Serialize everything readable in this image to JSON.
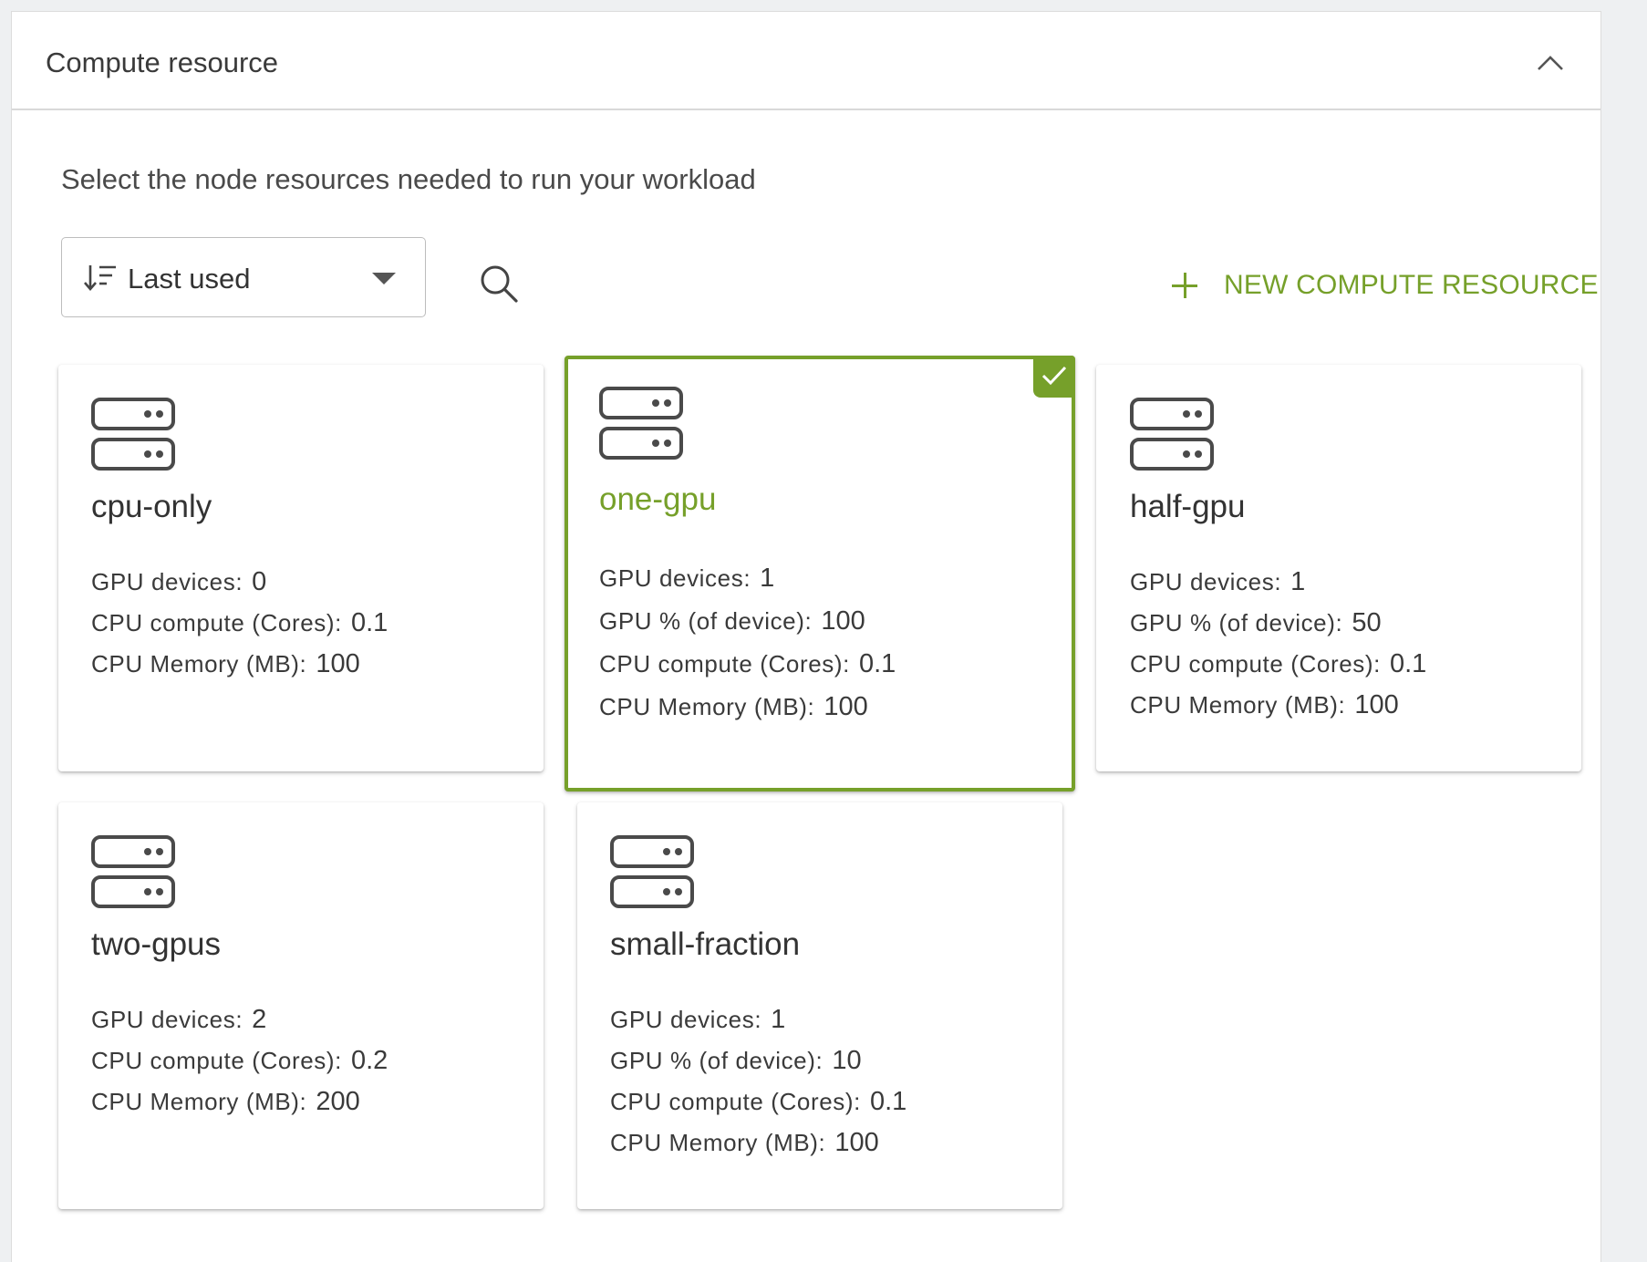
{
  "panel": {
    "title": "Compute resource",
    "collapse_icon": "chevron-up-icon"
  },
  "intro_text": "Select the node resources needed to run your workload",
  "toolbar": {
    "sort_label": "Last used",
    "sort_icon": "sort-descending-icon",
    "search_icon": "search-icon",
    "new_label": "NEW COMPUTE RESOURCE",
    "accent_color": "#76a02a"
  },
  "cards": [
    {
      "name": "cpu-only",
      "selected": false,
      "specs": [
        {
          "label": "GPU devices:",
          "value": "0"
        },
        {
          "label": "CPU compute (Cores):",
          "value": "0.1"
        },
        {
          "label": "CPU Memory (MB):",
          "value": "100"
        }
      ]
    },
    {
      "name": "one-gpu",
      "selected": true,
      "specs": [
        {
          "label": "GPU devices:",
          "value": "1"
        },
        {
          "label": "GPU % (of device):",
          "value": "100"
        },
        {
          "label": "CPU compute (Cores):",
          "value": "0.1"
        },
        {
          "label": "CPU Memory (MB):",
          "value": "100"
        }
      ]
    },
    {
      "name": "half-gpu",
      "selected": false,
      "specs": [
        {
          "label": "GPU devices:",
          "value": "1"
        },
        {
          "label": "GPU % (of device):",
          "value": "50"
        },
        {
          "label": "CPU compute (Cores):",
          "value": "0.1"
        },
        {
          "label": "CPU Memory (MB):",
          "value": "100"
        }
      ]
    },
    {
      "name": "two-gpus",
      "selected": false,
      "specs": [
        {
          "label": "GPU devices:",
          "value": "2"
        },
        {
          "label": "CPU compute (Cores):",
          "value": "0.2"
        },
        {
          "label": "CPU Memory (MB):",
          "value": "200"
        }
      ]
    },
    {
      "name": "small-fraction",
      "selected": false,
      "specs": [
        {
          "label": "GPU devices:",
          "value": "1"
        },
        {
          "label": "GPU % (of device):",
          "value": "10"
        },
        {
          "label": "CPU compute (Cores):",
          "value": "0.1"
        },
        {
          "label": "CPU Memory (MB):",
          "value": "100"
        }
      ]
    }
  ]
}
